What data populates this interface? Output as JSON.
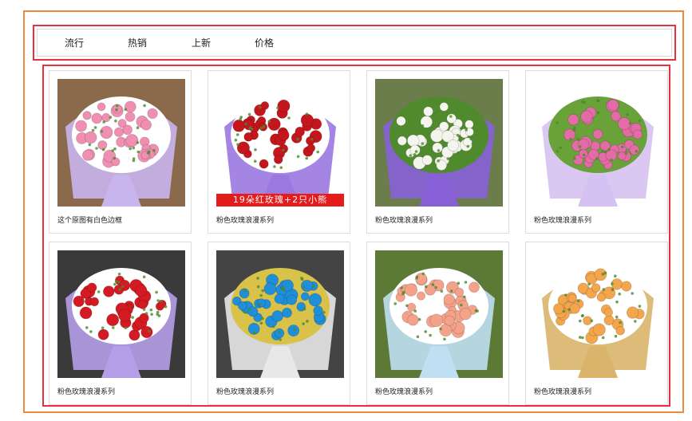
{
  "nav": {
    "items": [
      {
        "label": "流行"
      },
      {
        "label": "热销"
      },
      {
        "label": "上新"
      },
      {
        "label": "价格"
      }
    ]
  },
  "products": [
    {
      "caption": "这个原图有白色边框",
      "image": "pink-carnation-bouquet",
      "colors": {
        "bg": "#8a6a4a",
        "wrap": "#c9b5ee",
        "flower": "#f08fb1",
        "accent": "#ffffff"
      }
    },
    {
      "caption": "粉色玫瑰浪漫系列",
      "image": "red-rose-bouquet-with-bears",
      "banner": "19朵红玫瑰+2只小熊",
      "colors": {
        "bg": "#ffffff",
        "wrap": "#9a78e0",
        "flower": "#c5161d",
        "accent": "#ffffff"
      }
    },
    {
      "caption": "粉色玫瑰浪漫系列",
      "image": "white-lily-bouquet",
      "colors": {
        "bg": "#6b7d4a",
        "wrap": "#8760d8",
        "flower": "#f4f6ee",
        "accent": "#4f8a2c"
      }
    },
    {
      "caption": "粉色玫瑰浪漫系列",
      "image": "pink-rose-bouquet",
      "colors": {
        "bg": "#ffffff",
        "wrap": "#d6c2f2",
        "flower": "#e36ba6",
        "accent": "#6aa23a"
      }
    },
    {
      "caption": "粉色玫瑰浪漫系列",
      "image": "red-rose-bouquet-with-bears",
      "colors": {
        "bg": "#3a3a3a",
        "wrap": "#b59ee8",
        "flower": "#d41a22",
        "accent": "#ffffff"
      }
    },
    {
      "caption": "粉色玫瑰浪漫系列",
      "image": "blue-rose-bouquet-with-bears",
      "colors": {
        "bg": "#444444",
        "wrap": "#e8e8e8",
        "flower": "#1e8fd8",
        "accent": "#d8c24a"
      }
    },
    {
      "caption": "粉色玫瑰浪漫系列",
      "image": "peach-rose-bouquet",
      "colors": {
        "bg": "#5c7a36",
        "wrap": "#bfe0f2",
        "flower": "#f5a28a",
        "accent": "#ffffff"
      }
    },
    {
      "caption": "粉色玫瑰浪漫系列",
      "image": "champagne-rose-bouquet-with-bears",
      "colors": {
        "bg": "#ffffff",
        "wrap": "#d9b46a",
        "flower": "#f3a64c",
        "accent": "#ffffff"
      }
    }
  ]
}
